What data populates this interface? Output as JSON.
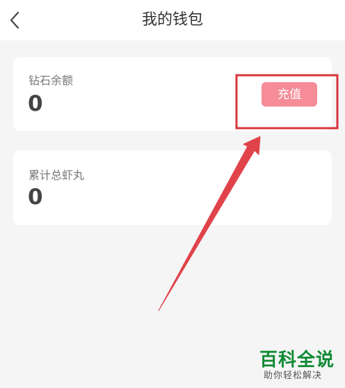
{
  "header": {
    "title": "我的钱包"
  },
  "wallet": {
    "diamond": {
      "label": "钻石余额",
      "value": "0",
      "recharge_label": "充值"
    },
    "shrimp": {
      "label": "累计总虾丸",
      "value": "0"
    }
  },
  "watermark": {
    "title": "百科全说",
    "subtitle": "助你轻松解决"
  },
  "colors": {
    "accent": "#f58c97",
    "annotation": "#d9343d",
    "watermark": "#0f8a34",
    "background": "#f5f5f5"
  },
  "icons": {
    "back": "chevron-left-icon"
  }
}
